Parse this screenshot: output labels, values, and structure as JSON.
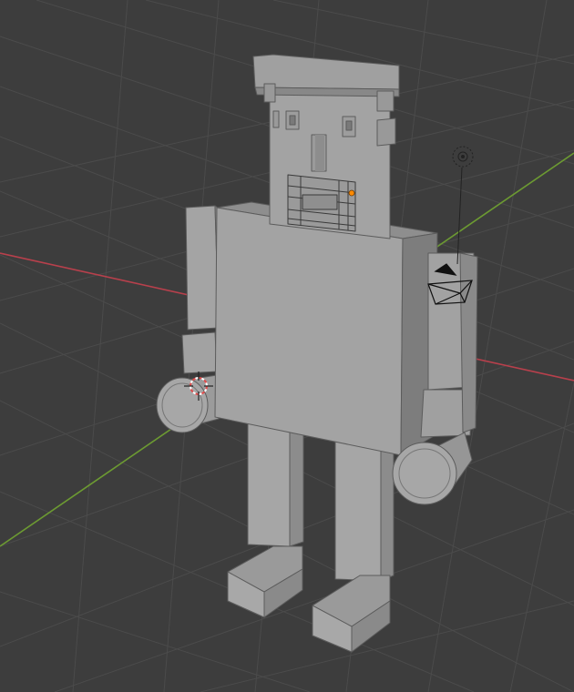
{
  "viewport": {
    "name": "3D Viewport",
    "background": "#3d3d3d",
    "grid_color": "#4a4a4a",
    "x_axis_color": "#b8404c",
    "y_axis_color": "#6c9a32"
  },
  "scene": {
    "object_name": "robot-model",
    "face_light": "#a3a3a3",
    "face_mid": "#8e8e8e",
    "face_dark": "#6f6f6f",
    "edge": "#5a5a5a",
    "origin_point_color": "#ff8a00"
  },
  "icons": {
    "cursor": "3d-cursor-icon",
    "light": "light-object-icon",
    "camera": "camera-object-icon"
  }
}
